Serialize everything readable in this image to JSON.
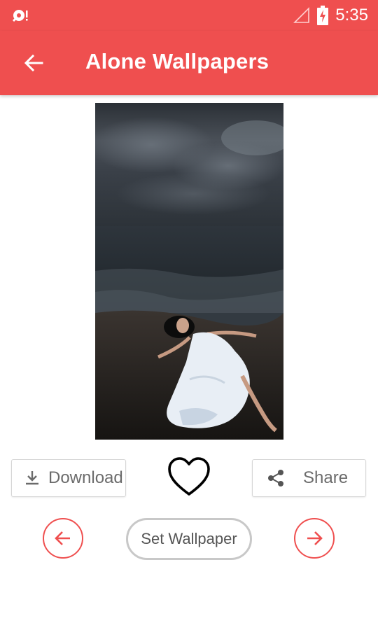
{
  "status_bar": {
    "time": "5:35",
    "left_icon": "notification-icon",
    "signal_icon": "signal-icon",
    "battery_icon": "battery-charging-icon"
  },
  "app_bar": {
    "title": "Alone Wallpapers",
    "back_icon": "back-arrow-icon"
  },
  "wallpaper": {
    "image": "wallpaper-photo"
  },
  "actions": {
    "download_label": "Download",
    "download_icon": "download-icon",
    "favorite_icon": "heart-icon",
    "share_label": "Share",
    "share_icon": "share-icon"
  },
  "navigation": {
    "prev_icon": "arrow-left-icon",
    "next_icon": "arrow-right-icon",
    "set_wallpaper_label": "Set Wallpaper"
  },
  "colors": {
    "accent": "#ef4f4f",
    "button_border": "#d6d6d6",
    "text_gray": "#6b6b6b"
  }
}
